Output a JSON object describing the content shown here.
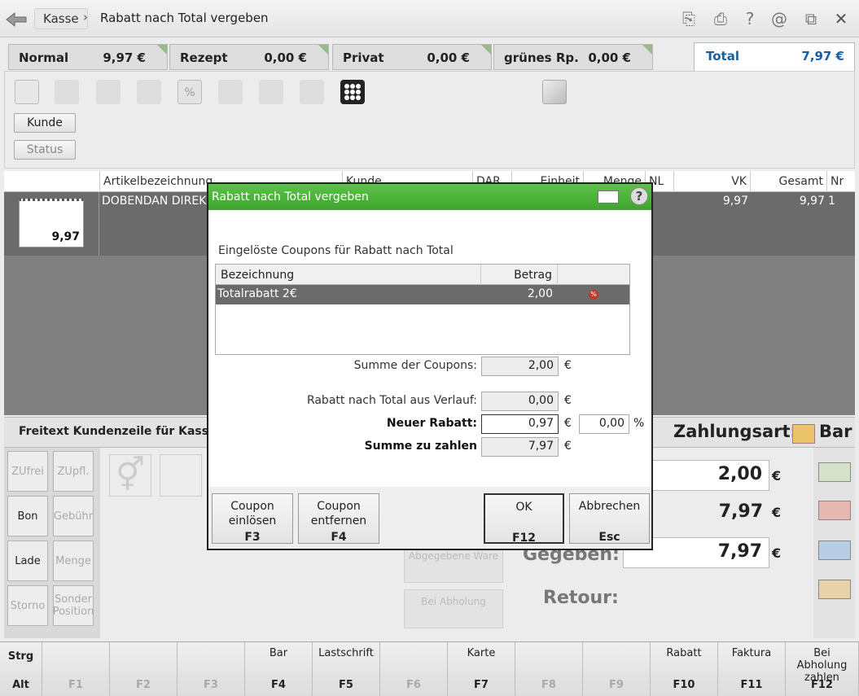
{
  "header": {
    "crumb_root": "Kasse",
    "crumb_sep": "›",
    "crumb_page": "Rabatt nach Total vergeben"
  },
  "tabs": [
    {
      "label": "Normal",
      "value": "9,97 €"
    },
    {
      "label": "Rezept",
      "value": "0,00 €"
    },
    {
      "label": "Privat",
      "value": "0,00 €"
    },
    {
      "label": "grünes Rp.",
      "value": "0,00 €"
    }
  ],
  "total_tab": {
    "label": "Total",
    "value": "7,97 €"
  },
  "toolbar": {
    "kunde": "Kunde",
    "status": "Status"
  },
  "table": {
    "headers": [
      "Artikelbezeichnung",
      "Kunde",
      "DAR",
      "Einheit",
      "Menge",
      "NL",
      "VK",
      "Gesamt",
      "Nr"
    ],
    "row": {
      "price_tag": "9,97",
      "name": "DOBENDAN DIREK",
      "vk": "9,97",
      "gesamt": "9,97",
      "nr": "1"
    }
  },
  "lower": {
    "freitext": "Freitext Kundenzeile für Kassenb",
    "zahlungsart_label": "Zahlungsart:",
    "zahlungsart_value": "Bar",
    "amount1": "2,00",
    "amount2": "7,97",
    "gegeben_label": "Gegeben:",
    "gegeben_value": "7,97",
    "retour_label": "Retour:",
    "euro": "€",
    "abgegebene_ware": "Abgegebene Ware",
    "bei_abholung": "Bei Abholung"
  },
  "side_buttons": [
    "ZUfrei",
    "ZUpfl.",
    "Bon",
    "Gebühr",
    "Lade",
    "Menge",
    "Storno",
    "Sonder Position"
  ],
  "fkeys": [
    {
      "label": "Strg",
      "key": "Alt"
    },
    {
      "label": "",
      "key": "F1"
    },
    {
      "label": "",
      "key": "F2"
    },
    {
      "label": "",
      "key": "F3"
    },
    {
      "label": "Bar",
      "key": "F4"
    },
    {
      "label": "Lastschrift",
      "key": "F5"
    },
    {
      "label": "",
      "key": "F6"
    },
    {
      "label": "Karte",
      "key": "F7"
    },
    {
      "label": "",
      "key": "F8"
    },
    {
      "label": "",
      "key": "F9"
    },
    {
      "label": "Rabatt",
      "key": "F10"
    },
    {
      "label": "Faktura",
      "key": "F11"
    },
    {
      "label": "Bei Abholung zahlen",
      "key": "F12"
    }
  ],
  "dialog": {
    "title": "Rabatt nach Total vergeben",
    "help": "?",
    "section": "Eingelöste Coupons für Rabatt nach Total",
    "col_bez": "Bezeichnung",
    "col_betrag": "Betrag",
    "coupon_name": "Totalrabatt 2€",
    "coupon_amount": "2,00",
    "summe_coupons_label": "Summe der Coupons:",
    "summe_coupons": "2,00",
    "verlauf_label": "Rabatt nach Total aus Verlauf:",
    "verlauf": "0,00",
    "neuer_label": "Neuer Rabatt:",
    "neuer": "0,97",
    "prozent": "0,00",
    "prozent_sign": "%",
    "zahlen_label": "Summe zu zahlen",
    "zahlen": "7,97",
    "euro": "€",
    "btn_einloesen": "Coupon einlösen",
    "key_einloesen": "F3",
    "btn_entfernen": "Coupon entfernen",
    "key_entfernen": "F4",
    "btn_ok": "OK",
    "key_ok": "F12",
    "btn_abbrechen": "Abbrechen",
    "key_abbrechen": "Esc"
  },
  "colors": {
    "accent_green": "#3ea52c",
    "total_blue": "#1a5fa6",
    "badge_red": "#c0392b"
  }
}
